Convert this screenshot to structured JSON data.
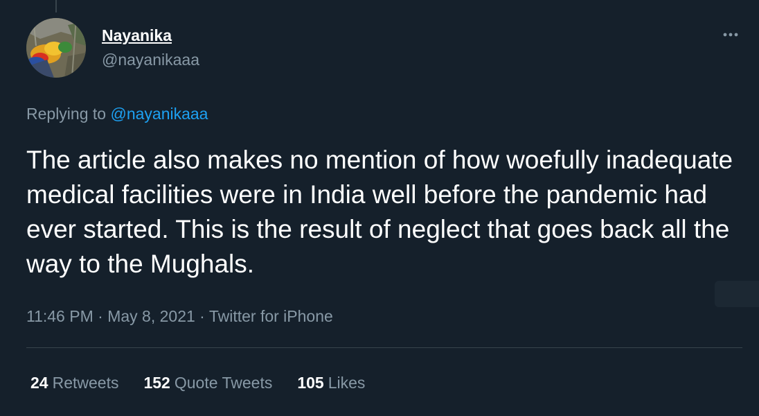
{
  "tweet": {
    "author": {
      "display_name": "Nayanika",
      "handle": "@nayanikaaa"
    },
    "replying_prefix": "Replying to ",
    "replying_to": "@nayanikaaa",
    "text": "The article also makes no mention of how woefully inadequate medical facilities were in India well before the pandemic had ever started. This is the result of neglect that goes back all the way to the Mughals.",
    "time": "11:46 PM",
    "separator": " · ",
    "date": "May 8, 2021",
    "source": "Twitter for iPhone",
    "stats": {
      "retweets_count": "24",
      "retweets_label": "Retweets",
      "quote_count": "152",
      "quote_label": "Quote Tweets",
      "likes_count": "105",
      "likes_label": "Likes"
    }
  },
  "colors": {
    "background": "#15202b",
    "primary_text": "#ffffff",
    "secondary_text": "#8899a6",
    "link": "#1da1f2",
    "divider": "#38444d"
  },
  "icons": {
    "more": "more-horizontal-icon"
  }
}
